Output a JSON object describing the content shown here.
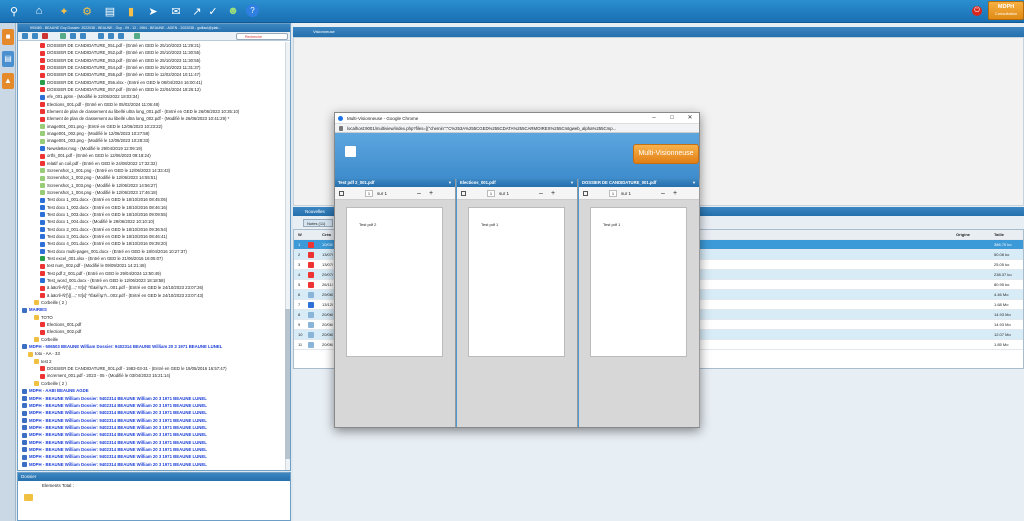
{
  "toolbar": {
    "mdph_title": "MDPH",
    "mdph_subtitle": "Consultation"
  },
  "tree": {
    "header": "993480 - BEAUNE Guy Dossier: 2022038 - BEAUNE - Guy - 09 - 12 - 1964 - BEAUNE - AGEN - 2022038 - guillaut@plab...",
    "search_label": "Recherche",
    "rows": [
      {
        "text": "DOSSIER DE CANDIDATURE_051.pdf - (Entré en GED le 25/10/2023 11:29:21)",
        "icon": "pdf",
        "indent": 22
      },
      {
        "text": "DOSSIER DE CANDIDATURE_052.pdf - (Entré en GED le 25/10/2023 11:30:55)",
        "icon": "pdf",
        "indent": 22
      },
      {
        "text": "DOSSIER DE CANDIDATURE_053.pdf - (Entré en GED le 25/10/2023 11:30:55)",
        "icon": "pdf",
        "indent": 22
      },
      {
        "text": "DOSSIER DE CANDIDATURE_054.pdf - (Entré en GED le 25/10/2023 11:31:37)",
        "icon": "pdf",
        "indent": 22
      },
      {
        "text": "DOSSIER DE CANDIDATURE_055.pdf - (Entré en GED le 12/02/2024 10:11:47)",
        "icon": "pdf",
        "indent": 22
      },
      {
        "text": "DOSSIER DE CANDIDATURE_056.xlsx - (Entré en GED le 08/04/2024 16:00:41)",
        "icon": "xls",
        "indent": 22
      },
      {
        "text": "DOSSIER DE CANDIDATURE_057.pdf - (Entré en GED le 22/04/2024 18:26:12)",
        "icon": "pdf",
        "indent": 22
      },
      {
        "text": "efe_001.pptm - (Modifié le 22/05/2022 18:03:34)",
        "icon": "doc",
        "indent": 22
      },
      {
        "text": "Elections_001.pdf - (Entré en GED le 05/02/2024 11:06:48)",
        "icon": "pdf",
        "indent": 22
      },
      {
        "text": "Element de plan de classement au libellé ultra long_001.pdf - (Entré en GED le 26/06/2023 10:35:10)",
        "icon": "pdf",
        "indent": 22
      },
      {
        "text": "Element de plan de classement au libellé ultra long_002.pdf - (Modifié le 26/06/2023 10:41:29) *",
        "icon": "pdf",
        "indent": 22
      },
      {
        "text": "image001_001.png - (Entré en GED le 12/06/2023 10:23:22)",
        "icon": "img",
        "indent": 22
      },
      {
        "text": "image001_002.png - (Modifié le 12/06/2023 10:27:58)",
        "icon": "img",
        "indent": 22
      },
      {
        "text": "image001_003.png - (Modifié le 12/06/2023 10:28:33)",
        "icon": "img",
        "indent": 22
      },
      {
        "text": "Newsletter.msg - (Modifié le 29/04/2019 12:09:19)",
        "icon": "doc",
        "indent": 22
      },
      {
        "text": "ortfs_001.pdf - (Entré en GED le 12/06/2023 09:18:24)",
        "icon": "pdf",
        "indent": 22
      },
      {
        "text": "relatif un coil.pdf - (Entré en GED le 24/08/2022 17:32:32)",
        "icon": "pdf",
        "indent": 22
      },
      {
        "text": "Screenshot_1_001.png - (Entré en GED le 12/06/2023 14:33:43)",
        "icon": "img",
        "indent": 22
      },
      {
        "text": "Screenshot_1_002.png - (Modifié le 12/06/2023 14:55:51)",
        "icon": "img",
        "indent": 22
      },
      {
        "text": "Screenshot_1_003.png - (Modifié le 12/06/2023 14:56:27)",
        "icon": "img",
        "indent": 22
      },
      {
        "text": "Screenshot_1_004.png - (Modifié le 12/06/2023 17:46:18)",
        "icon": "img",
        "indent": 22
      },
      {
        "text": "Test docx 1_001.docx - (Entré en GED le 18/10/2016 08:45:05)",
        "icon": "doc",
        "indent": 22
      },
      {
        "text": "Test docx 1_002.docx - (Entré en GED le 18/10/2016 08:46:16)",
        "icon": "doc",
        "indent": 22
      },
      {
        "text": "Test docx 1_003.docx - (Entré en GED le 18/10/2016 09:09:55)",
        "icon": "doc",
        "indent": 22
      },
      {
        "text": "Test docx 1_004.docx - (Modifié le 29/06/2022 10:10:10)",
        "icon": "doc",
        "indent": 22
      },
      {
        "text": "Test docx 2_001.docx - (Entré en GED le 18/10/2016 09:36:54)",
        "icon": "doc",
        "indent": 22
      },
      {
        "text": "Test docx 3_001.docx - (Entré en GED le 18/10/2016 08:46:41)",
        "icon": "doc",
        "indent": 22
      },
      {
        "text": "Test docx 4_001.docx - (Entré en GED le 18/10/2016 09:39:20)",
        "icon": "doc",
        "indent": 22
      },
      {
        "text": "Test docx multi-pages_001.docx - (Entré en GED le 18/04/2016 10:27:37)",
        "icon": "doc",
        "indent": 22
      },
      {
        "text": "Test excel_001.xlsx - (Entré en GED le 21/06/2016 16:05:07)",
        "icon": "xls",
        "indent": 22
      },
      {
        "text": "test num_002.pdf - (Modifié le 09/09/2021 14:21:48)",
        "icon": "pdf",
        "indent": 22
      },
      {
        "text": "Test pdf 2_001.pdf - (Entré en GED le 29/04/2024 12:50:49)",
        "icon": "pdf",
        "indent": 22
      },
      {
        "text": "Test_word_001.docx - (Entré en GED le 12/06/2023 18:18:58)",
        "icon": "doc",
        "indent": 22
      },
      {
        "text": "ä àäü'ê-Ñ'[\\[{...;' !t![x]' ^Ë&èî!µ?\\...001.pdf - (Entré en GED le 24/10/2023 23:07:26)",
        "icon": "pdf",
        "indent": 22
      },
      {
        "text": "ä àäü'ê-Ñ'[\\[{...;' !t![x]' ^Ë&èî!µ?\\...002.pdf - (Entré en GED le 24/10/2023 23:07:43)",
        "icon": "pdf",
        "indent": 22
      },
      {
        "text": "Corbeille ( 2 )",
        "icon": "folder",
        "indent": 16
      },
      {
        "text": "MAIRIES",
        "icon": "grp",
        "indent": 4,
        "style": "blue"
      },
      {
        "text": "TOTO",
        "icon": "folder",
        "indent": 16
      },
      {
        "text": "Elections_001.pdf",
        "icon": "pdf",
        "indent": 22
      },
      {
        "text": "Elections_002.pdf",
        "icon": "pdf",
        "indent": 22
      },
      {
        "text": "Corbeille",
        "icon": "folder",
        "indent": 16
      },
      {
        "text": "MDPH - 506503 BEAUNE William Dossier: 9402314 BEAUNE William 20 3 1971 BEAUNE LUNEL",
        "icon": "grp",
        "indent": 4,
        "style": "blue"
      },
      {
        "text": "toto - AA - 33",
        "icon": "folder",
        "indent": 10
      },
      {
        "text": "test 2",
        "icon": "folder",
        "indent": 16
      },
      {
        "text": "DOSSIER DE CANDIDATURE_001.pdf - 1983-03-31 - (Entré en GED le 19/05/2016 16:57:47)",
        "icon": "pdf",
        "indent": 22
      },
      {
        "text": "increment_001.pdf - 2023 - 05 - (Modifié le 03/04/2023 15:21:14)",
        "icon": "pdf",
        "indent": 22
      },
      {
        "text": "Corbeille ( 2 )",
        "icon": "folder",
        "indent": 16
      },
      {
        "text": "MDPH - AABI BEAUNE AGDE",
        "icon": "grp",
        "indent": 4,
        "style": "blue"
      },
      {
        "text": "MDPH - BEAUNE William Dossier: 9402314 BEAUNE William 20 3 1971 BEAUNE LUNEL",
        "icon": "grp",
        "indent": 4,
        "style": "blue"
      },
      {
        "text": "MDPH - BEAUNE William Dossier: 9402314 BEAUNE William 20 3 1971 BEAUNE LUNEL",
        "icon": "grp",
        "indent": 4,
        "style": "blue"
      },
      {
        "text": "MDPH - BEAUNE William Dossier: 9402314 BEAUNE William 20 3 1971 BEAUNE LUNEL",
        "icon": "grp",
        "indent": 4,
        "style": "blue"
      },
      {
        "text": "MDPH - BEAUNE William Dossier: 9402314 BEAUNE William 20 3 1971 BEAUNE LUNEL",
        "icon": "grp",
        "indent": 4,
        "style": "blue"
      },
      {
        "text": "MDPH - BEAUNE William Dossier: 9402314 BEAUNE William 20 3 1971 BEAUNE LUNEL",
        "icon": "grp",
        "indent": 4,
        "style": "blue"
      },
      {
        "text": "MDPH - BEAUNE William Dossier: 9402314 BEAUNE William 20 3 1971 BEAUNE LUNEL",
        "icon": "grp",
        "indent": 4,
        "style": "blue"
      },
      {
        "text": "MDPH - BEAUNE William Dossier: 9402314 BEAUNE William 20 3 1971 BEAUNE LUNEL",
        "icon": "grp",
        "indent": 4,
        "style": "blue"
      },
      {
        "text": "MDPH - BEAUNE William Dossier: 9402314 BEAUNE William 20 3 1971 BEAUNE LUNEL",
        "icon": "grp",
        "indent": 4,
        "style": "blue"
      },
      {
        "text": "MDPH - BEAUNE William Dossier: 9402314 BEAUNE William 20 3 1971 BEAUNE LUNEL",
        "icon": "grp",
        "indent": 4,
        "style": "blue"
      },
      {
        "text": "MDPH - BEAUNE William Dossier: 9402314 BEAUNE William 20 3 1971 BEAUNE LUNEL",
        "icon": "grp",
        "indent": 4,
        "style": "blue"
      }
    ]
  },
  "dossier": {
    "title": "Dossier",
    "total": "Elements Total :"
  },
  "viewer": {
    "title": "Visionneuse"
  },
  "notes": {
    "title": "Nouvelles",
    "tab": "Notes (11)",
    "columns": {
      "w": "W",
      "crea": "Créa",
      "origine": "Origine",
      "taille": "Taille"
    },
    "rows": [
      {
        "num": "1",
        "crea": "10/05/",
        "size": "386.70 ko",
        "icon": "pdf"
      },
      {
        "num": "2",
        "crea": "13/07/",
        "size": "50.08 ko",
        "icon": "pdf"
      },
      {
        "num": "3",
        "crea": "13/07/",
        "size": "25.05 ko",
        "icon": "pdf"
      },
      {
        "num": "4",
        "crea": "29/07/",
        "size": "238.37 ko",
        "icon": "pdf"
      },
      {
        "num": "5",
        "crea": "26/11/",
        "size": "80.95 ko",
        "icon": "pdf"
      },
      {
        "num": "6",
        "crea": "29/06/",
        "size": "4.46 Mo",
        "icon": "img"
      },
      {
        "num": "7",
        "crea": "13/12/",
        "size": "1.68 Mo",
        "icon": "doc"
      },
      {
        "num": "8",
        "crea": "20/06/",
        "size": "14.93 Mo",
        "icon": "img"
      },
      {
        "num": "9",
        "crea": "20/06/",
        "size": "14.93 Mo",
        "icon": "img"
      },
      {
        "num": "10",
        "crea": "20/06/",
        "size": "12.07 Mo",
        "icon": "img"
      },
      {
        "num": "11",
        "crea": "20/06/",
        "size": "1.85 Mo",
        "icon": "img"
      }
    ]
  },
  "popup": {
    "window_title": "Multi-Visionneuse - Google Chrome",
    "url": "localhost:9001/multiview/index.php?files=[{\"chemin\":\"C%253A%255CGED%255CDATA%255CARMOIRES%255Cmtgweb_alpha%255Cmp...",
    "multi_button": "Multi-Visionneuse",
    "panes": [
      {
        "title": "Test pdf 2_001.pdf",
        "page": "1",
        "total": "sur 1",
        "content": "Test pdf 2"
      },
      {
        "title": "Elections_001.pdf",
        "page": "1",
        "total": "sur 1",
        "content": "Test pdf 1"
      },
      {
        "title": "DOSSIER DE CANDIDATURE_001.pdf",
        "page": "1",
        "total": "sur 1",
        "content": "Test pdf 1"
      }
    ]
  }
}
